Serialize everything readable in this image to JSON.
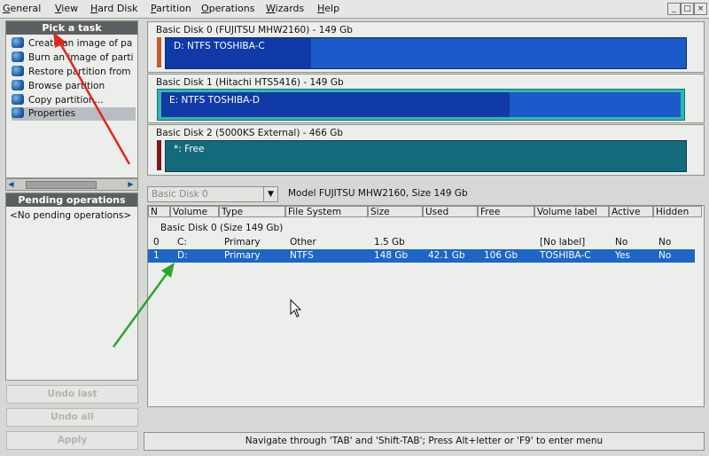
{
  "menu": {
    "items": [
      "General",
      "View",
      "Hard Disk",
      "Partition",
      "Operations",
      "Wizards",
      "Help"
    ],
    "window_buttons": [
      "_",
      "□",
      "×"
    ]
  },
  "tasks_panel": {
    "title": "Pick a task",
    "items": [
      {
        "label": "Create an image of pa",
        "icon": "create-image-icon"
      },
      {
        "label": "Burn an image of parti",
        "icon": "burn-image-icon"
      },
      {
        "label": "Restore partition from",
        "icon": "restore-partition-icon"
      },
      {
        "label": "Browse partition",
        "icon": "browse-partition-icon"
      },
      {
        "label": "Copy partition...",
        "icon": "copy-partition-icon"
      },
      {
        "label": "Properties",
        "icon": "properties-icon"
      }
    ]
  },
  "pending_panel": {
    "title": "Pending operations",
    "empty_text": "<No pending operations>"
  },
  "left_buttons": {
    "undo_last": "Undo last",
    "undo_all": "Undo all",
    "apply": "Apply"
  },
  "disks": [
    {
      "title": "Basic Disk 0 (FUJITSU MHW2160) - 149 Gb",
      "partition_label": "D: NTFS TOSHIBA-C",
      "used_fraction": 0.28
    },
    {
      "title": "Basic Disk 1 (Hitachi HTS5416) - 149 Gb",
      "partition_label": "E: NTFS TOSHIBA-D",
      "used_fraction": 0.67
    },
    {
      "title": "Basic Disk 2 (5000KS External) - 466 Gb",
      "partition_label": "*: Free",
      "used_fraction": 0
    }
  ],
  "details": {
    "disk_select_value": "Basic Disk 0",
    "model_text": "Model FUJITSU MHW2160, Size 149 Gb",
    "columns": [
      "N",
      "Volume",
      "Type",
      "File System",
      "Size",
      "Used",
      "Free",
      "Volume label",
      "Active",
      "Hidden"
    ],
    "group_label": "Basic Disk 0 (Size 149 Gb)",
    "rows": [
      [
        "0",
        "C:",
        "Primary",
        "Other",
        "1.5 Gb",
        "",
        "",
        "[No label]",
        "No",
        "No"
      ],
      [
        "1",
        "D:",
        "Primary",
        "NTFS",
        "148 Gb",
        "42.1 Gb",
        "106 Gb",
        "TOSHIBA-C",
        "Yes",
        "No"
      ]
    ],
    "selected_row": 1
  },
  "status_bar": {
    "text": "Navigate through 'TAB' and 'Shift-TAB'; Press Alt+letter or 'F9' to enter menu"
  },
  "colors": {
    "partition_blue": "#1a5bc9",
    "partition_used": "#0f3aa8",
    "free_teal": "#136a7c",
    "selection": "#1d66c6",
    "annotation_red": "#e0281c",
    "annotation_green": "#2aa52a"
  }
}
